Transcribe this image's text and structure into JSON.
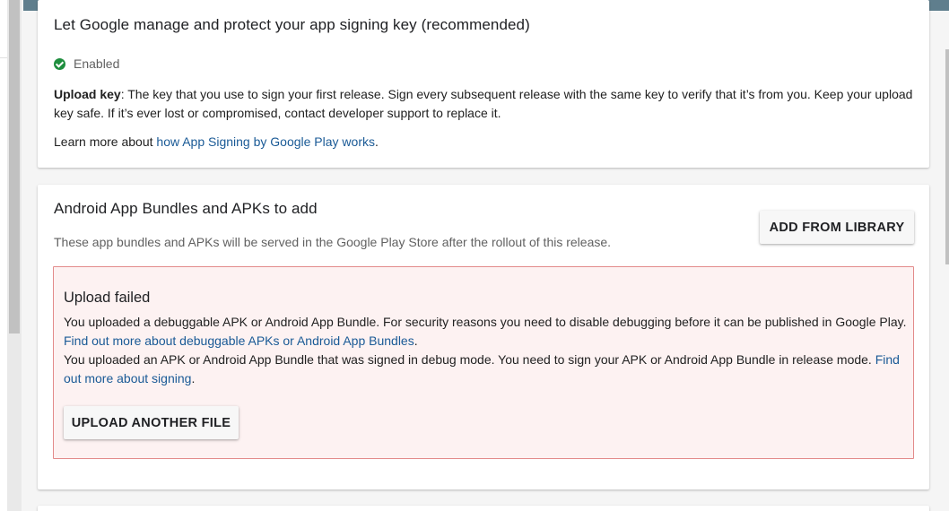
{
  "signing_card": {
    "title": "Let Google manage and protect your app signing key (recommended)",
    "status": "Enabled",
    "upload_key_label": "Upload key",
    "upload_key_text": ": The key that you use to sign your first release. Sign every subsequent release with the same key to verify that it’s from you. Keep your upload key safe. If it’s ever lost or compromised, contact developer support to replace it.",
    "learn_prefix": "Learn more about ",
    "learn_link": "how App Signing by Google Play works",
    "learn_suffix": "."
  },
  "bundles_card": {
    "title": "Android App Bundles and APKs to add",
    "subtitle": "These app bundles and APKs will be served in the Google Play Store after the rollout of this release.",
    "add_button": "ADD FROM LIBRARY",
    "error": {
      "title": "Upload failed",
      "line1": "You uploaded a debuggable APK or Android App Bundle. For security reasons you need to disable debugging before it can be published in Google Play.",
      "link1": "Find out more about debuggable APKs or Android App Bundles",
      "link1_suffix": ".",
      "line2": "You uploaded an APK or Android App Bundle that was signed in debug mode. You need to sign your APK or Android App Bundle in release mode. ",
      "link2": "Find out more about signing",
      "link2_suffix": ".",
      "upload_button": "UPLOAD ANOTHER FILE"
    }
  },
  "colors": {
    "topbar": "#5f7e8d",
    "link": "#1a5a96",
    "success": "#1e8e3e",
    "error_border": "#e38b8b",
    "error_bg": "#fdf2f2"
  }
}
